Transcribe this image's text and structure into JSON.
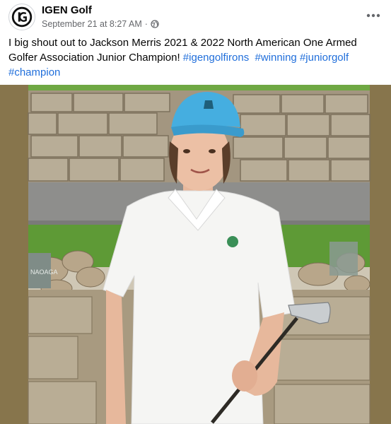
{
  "post": {
    "author": "IGEN Golf",
    "timestamp": "September 21 at 8:27 AM",
    "separator": "·",
    "caption_text": "I big shout out to Jackson Merris 2021 & 2022 North American One  Armed Golfer Association Junior Champion! ",
    "hashtags": [
      "#igengolfirons",
      "#winning",
      "#juniorgolf",
      "#champion"
    ],
    "photo_logo_text": "NAOAGA",
    "icons": {
      "avatar": "igen-logo-icon",
      "privacy": "globe-icon",
      "menu": "more-options-icon"
    }
  },
  "colors": {
    "hashtag": "#216fdb",
    "meta_text": "#65676b",
    "photo_border": "#87754c"
  }
}
